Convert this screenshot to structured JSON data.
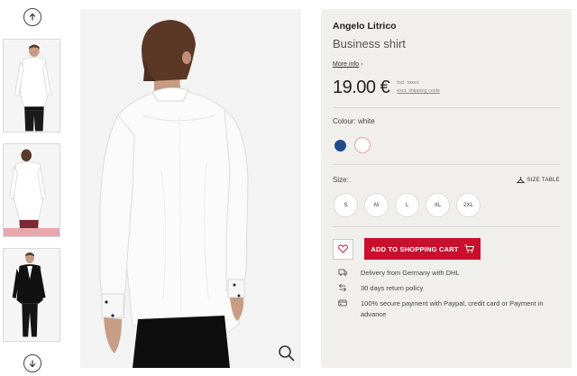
{
  "gallery": {
    "up_arrow_icon": "arrow-up-icon",
    "down_arrow_icon": "arrow-down-icon",
    "thumbnails": [
      {
        "name": "front-view",
        "selected": false
      },
      {
        "name": "back-view",
        "selected": true
      },
      {
        "name": "suit-view",
        "selected": false
      }
    ],
    "zoom_icon": "zoom-icon"
  },
  "product": {
    "brand": "Angelo Litrico",
    "name": "Business shirt",
    "more_info": "More info",
    "price": "19.00 €",
    "incl_taxes": "incl. taxes",
    "excl_shipping": "excl. shipping costs"
  },
  "colour": {
    "label": "Colour: white",
    "options": [
      {
        "name": "blue",
        "color": "#234a8d",
        "selected": false
      },
      {
        "name": "white",
        "color": "#ffffff",
        "selected": true
      }
    ]
  },
  "size": {
    "label": "Size:",
    "size_table": "SIZE TABLE",
    "options": [
      "S",
      "M",
      "L",
      "XL",
      "2XL"
    ]
  },
  "actions": {
    "add_to_cart": "ADD TO SHOPPING CART",
    "accent_color": "#c8102e"
  },
  "benefits": [
    {
      "icon": "delivery-icon",
      "text": "Delivery from Germany with DHL"
    },
    {
      "icon": "return-icon",
      "text": "30 days return policy"
    },
    {
      "icon": "payment-icon",
      "text": "100% secure payment with Paypal, credit card or Payment in advance"
    }
  ]
}
